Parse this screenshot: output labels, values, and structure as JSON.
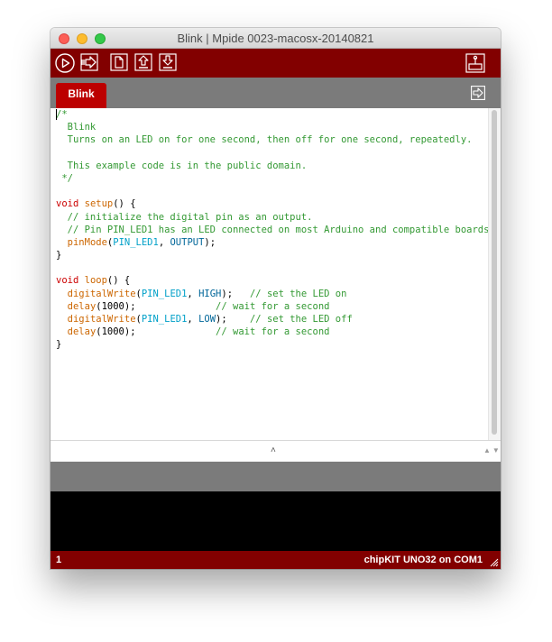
{
  "window": {
    "title": "Blink | Mpide 0023-macosx-20140821"
  },
  "toolbar": {
    "buttons": [
      {
        "name": "verify",
        "icon": "play-icon"
      },
      {
        "name": "upload",
        "icon": "upload-arrow-icon"
      },
      {
        "name": "new",
        "icon": "new-file-icon"
      },
      {
        "name": "open",
        "icon": "open-up-arrow-icon"
      },
      {
        "name": "save",
        "icon": "save-down-arrow-icon"
      },
      {
        "name": "serial-monitor",
        "icon": "serial-monitor-icon"
      }
    ]
  },
  "tabs": [
    {
      "label": "Blink",
      "active": true
    }
  ],
  "editor": {
    "code_lines": [
      [
        {
          "t": "/*",
          "c": "c-comment"
        }
      ],
      [
        {
          "t": "  Blink",
          "c": "c-comment"
        }
      ],
      [
        {
          "t": "  Turns on an LED on for one second, then off for one second, repeatedly.",
          "c": "c-comment"
        }
      ],
      [
        {
          "t": " ",
          "c": ""
        }
      ],
      [
        {
          "t": "  This example code is in the public domain.",
          "c": "c-comment"
        }
      ],
      [
        {
          "t": " */",
          "c": "c-comment"
        }
      ],
      [
        {
          "t": " ",
          "c": ""
        }
      ],
      [
        {
          "t": "void",
          "c": "c-type"
        },
        {
          "t": " ",
          "c": ""
        },
        {
          "t": "setup",
          "c": "c-keyword"
        },
        {
          "t": "() {",
          "c": ""
        }
      ],
      [
        {
          "t": "  // initialize the digital pin as an output.",
          "c": "c-comment"
        }
      ],
      [
        {
          "t": "  // Pin PIN_LED1 has an LED connected on most Arduino and compatible boards:",
          "c": "c-comment"
        }
      ],
      [
        {
          "t": "  ",
          "c": ""
        },
        {
          "t": "pinMode",
          "c": "c-func"
        },
        {
          "t": "(",
          "c": ""
        },
        {
          "t": "PIN_LED1",
          "c": "c-pin"
        },
        {
          "t": ", ",
          "c": ""
        },
        {
          "t": "OUTPUT",
          "c": "c-const"
        },
        {
          "t": ");",
          "c": ""
        }
      ],
      [
        {
          "t": "}",
          "c": ""
        }
      ],
      [
        {
          "t": " ",
          "c": ""
        }
      ],
      [
        {
          "t": "void",
          "c": "c-type"
        },
        {
          "t": " ",
          "c": ""
        },
        {
          "t": "loop",
          "c": "c-keyword"
        },
        {
          "t": "() {",
          "c": ""
        }
      ],
      [
        {
          "t": "  ",
          "c": ""
        },
        {
          "t": "digitalWrite",
          "c": "c-func"
        },
        {
          "t": "(",
          "c": ""
        },
        {
          "t": "PIN_LED1",
          "c": "c-pin"
        },
        {
          "t": ", ",
          "c": ""
        },
        {
          "t": "HIGH",
          "c": "c-const"
        },
        {
          "t": ");   ",
          "c": ""
        },
        {
          "t": "// set the LED on",
          "c": "c-comment"
        }
      ],
      [
        {
          "t": "  ",
          "c": ""
        },
        {
          "t": "delay",
          "c": "c-func"
        },
        {
          "t": "(1000);              ",
          "c": ""
        },
        {
          "t": "// wait for a second",
          "c": "c-comment"
        }
      ],
      [
        {
          "t": "  ",
          "c": ""
        },
        {
          "t": "digitalWrite",
          "c": "c-func"
        },
        {
          "t": "(",
          "c": ""
        },
        {
          "t": "PIN_LED1",
          "c": "c-pin"
        },
        {
          "t": ", ",
          "c": ""
        },
        {
          "t": "LOW",
          "c": "c-const"
        },
        {
          "t": ");    ",
          "c": ""
        },
        {
          "t": "// set the LED off",
          "c": "c-comment"
        }
      ],
      [
        {
          "t": "  ",
          "c": ""
        },
        {
          "t": "delay",
          "c": "c-func"
        },
        {
          "t": "(1000);              ",
          "c": ""
        },
        {
          "t": "// wait for a second",
          "c": "c-comment"
        }
      ],
      [
        {
          "t": "}",
          "c": ""
        }
      ]
    ]
  },
  "footer": {
    "line_number": "1",
    "board": "chipKIT UNO32 on COM1"
  },
  "colors": {
    "toolbar": "#820000",
    "tab_active": "#bc0000",
    "tab_bar": "#7b7b7b",
    "console": "#000000"
  }
}
